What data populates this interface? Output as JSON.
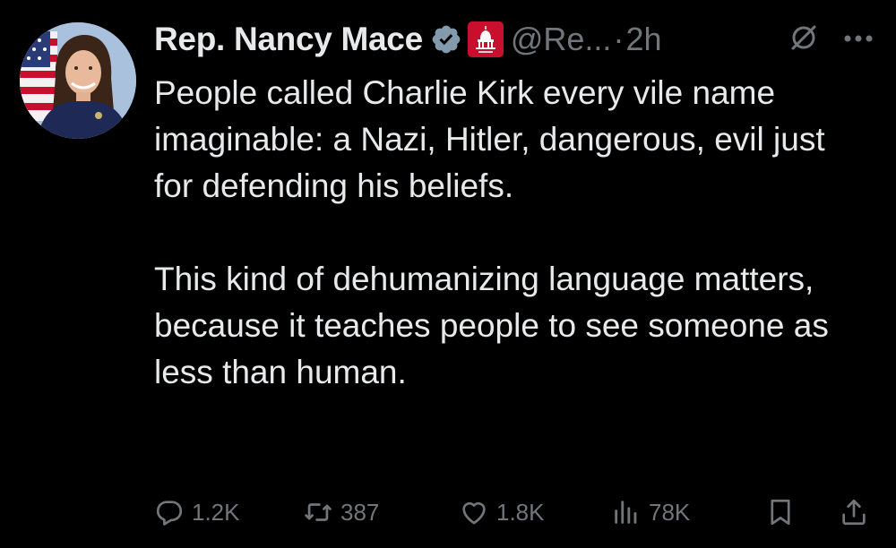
{
  "tweet": {
    "display_name": "Rep. Nancy Mace",
    "handle": "@Re...",
    "separator": "·",
    "time": "2h",
    "body_paragraph_1": "People called Charlie Kirk every vile name imaginable: a Nazi, Hitler, dangerous, evil  just for defending his beliefs.",
    "body_paragraph_2": "This kind of dehumanizing language matters, because it teaches people to see someone as less than human."
  },
  "actions": {
    "replies": "1.2K",
    "reposts": "387",
    "likes": "1.8K",
    "views": "78K"
  },
  "icons": {
    "verified": "verified-badge-icon",
    "affiliate": "house-gop-badge-icon",
    "mute": "mute-icon",
    "more": "more-icon",
    "reply": "reply-icon",
    "repost": "repost-icon",
    "like": "heart-icon",
    "views": "views-icon",
    "bookmark": "bookmark-icon",
    "share": "share-icon"
  },
  "colors": {
    "background": "#000000",
    "text": "#e7e9ea",
    "secondary": "#71767b",
    "verified": "#829aab",
    "affiliate_badge": "#c8102e"
  }
}
